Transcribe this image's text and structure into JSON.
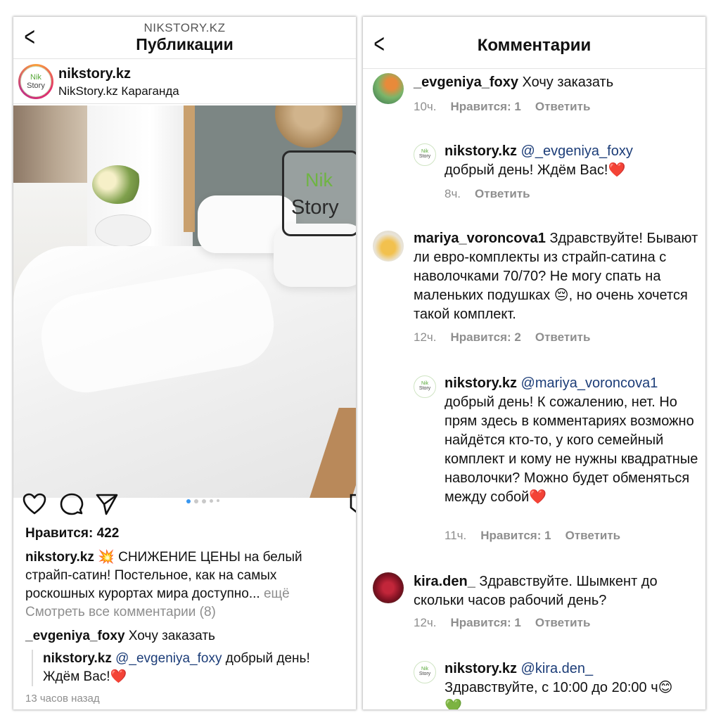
{
  "left": {
    "header": {
      "subtitle": "NIKSTORY.KZ",
      "title": "Публикации"
    },
    "account": {
      "username": "nikstory.kz",
      "location": "NikStory.kz Караганда",
      "avatar_text_1": "Nik",
      "avatar_text_2": "Story"
    },
    "photo": {
      "watermark_1": "Nik",
      "watermark_2": "Story"
    },
    "likes": "Нравится: 422",
    "caption": {
      "username": "nikstory.kz",
      "emoji": "💥",
      "text": " СНИЖЕНИЕ ЦЕНЫ на белый страйп-сатин! Постельное, как на самых роскошных курортах мира доступно...",
      "more": " ещё"
    },
    "view_all": "Смотреть все комментарии (8)",
    "comment": {
      "username": "_evgeniya_foxy",
      "text": " Хочу заказать"
    },
    "reply": {
      "username": "nikstory.kz",
      "mention": " @_evgeniya_foxy",
      "text": " добрый день! Ждём Вас!",
      "emoji": "❤️"
    },
    "time_ago": "13 часов назад"
  },
  "right": {
    "header": {
      "title": "Комментарии"
    },
    "comments": [
      {
        "username": "_evgeniya_foxy",
        "text": " Хочу заказать",
        "time": "10ч.",
        "likes": "Нравится: 1",
        "reply": "Ответить",
        "replies": [
          {
            "username": "nikstory.kz",
            "mention": " @_evgeniya_foxy",
            "text": " добрый день! Ждём Вас!",
            "emoji": "❤️",
            "time": "8ч.",
            "reply": "Ответить"
          }
        ]
      },
      {
        "username": "mariya_voroncova1",
        "text": " Здравствуйте! Бывают ли евро-комплекты из страйп-сатина с наволочками 70/70? Не могу спать на маленьких подушках",
        "emoji": "😔",
        "text_after": ", но очень хочется такой комплект.",
        "time": "12ч.",
        "likes": "Нравится: 2",
        "reply": "Ответить",
        "replies": [
          {
            "username": "nikstory.kz",
            "mention": " @mariya_voroncova1",
            "text": " добрый день! К сожалению, нет. Но прям здесь в комментариях возможно найдётся кто-то, у кого семейный комплект и кому не нужны квадратные наволочки? Можно будет обменяться между собой",
            "emoji": "❤️",
            "time": "11ч.",
            "likes": "Нравится: 1",
            "reply": "Ответить"
          }
        ]
      },
      {
        "username": "kira.den_",
        "text": " Здравствуйте.  Шымкент до скольки  часов рабочий день?",
        "time": "12ч.",
        "likes": "Нравится: 1",
        "reply": "Ответить",
        "replies": [
          {
            "username": "nikstory.kz",
            "mention": " @kira.den_",
            "text": "Здравствуйте, с 10:00 до 20:00 ч",
            "emoji": "😊",
            "emoji2": "💚"
          }
        ]
      }
    ]
  }
}
